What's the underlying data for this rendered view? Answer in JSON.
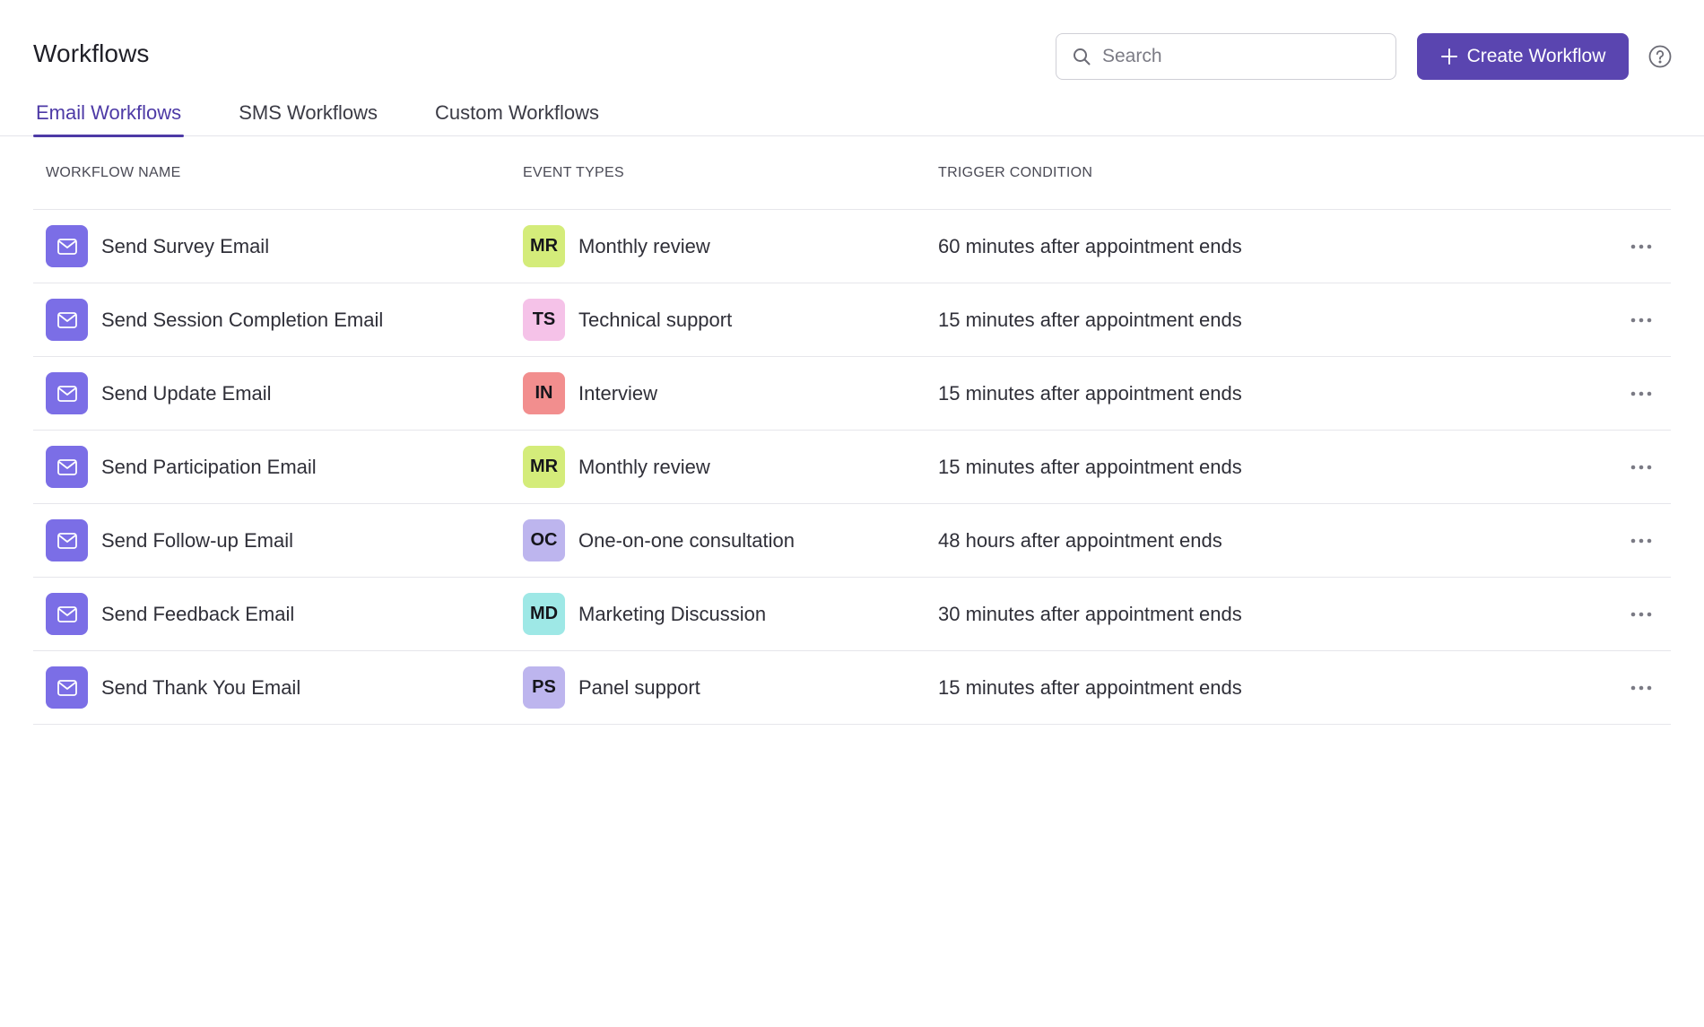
{
  "header": {
    "title": "Workflows",
    "search": {
      "placeholder": "Search",
      "value": ""
    },
    "create_button_label": "Create Workflow"
  },
  "tabs": [
    {
      "label": "Email Workflows",
      "active": true
    },
    {
      "label": "SMS Workflows",
      "active": false
    },
    {
      "label": "Custom Workflows",
      "active": false
    }
  ],
  "table": {
    "columns": [
      "WORKFLOW NAME",
      "EVENT TYPES",
      "TRIGGER CONDITION"
    ],
    "rows": [
      {
        "name": "Send Survey Email",
        "event_abbr": "MR",
        "event_color": "#d4ec7a",
        "event": "Monthly review",
        "trigger": "60 minutes after appointment ends"
      },
      {
        "name": "Send Session Completion Email",
        "event_abbr": "TS",
        "event_color": "#f5c2e8",
        "event": "Technical support",
        "trigger": "15 minutes after appointment ends"
      },
      {
        "name": "Send Update Email",
        "event_abbr": "IN",
        "event_color": "#f28e8e",
        "event": "Interview",
        "trigger": "15 minutes after appointment ends"
      },
      {
        "name": "Send Participation Email",
        "event_abbr": "MR",
        "event_color": "#d4ec7a",
        "event": "Monthly review",
        "trigger": "15 minutes after appointment ends"
      },
      {
        "name": "Send Follow-up Email",
        "event_abbr": "OC",
        "event_color": "#bdb5ee",
        "event": "One-on-one consultation",
        "trigger": "48 hours after appointment ends"
      },
      {
        "name": "Send Feedback Email",
        "event_abbr": "MD",
        "event_color": "#9ee8e6",
        "event": "Marketing Discussion",
        "trigger": "30 minutes after appointment ends"
      },
      {
        "name": "Send Thank You Email",
        "event_abbr": "PS",
        "event_color": "#bdb5ee",
        "event": "Panel support",
        "trigger": "15 minutes after appointment ends"
      }
    ]
  },
  "colors": {
    "accent": "#5a45b0",
    "active_tab": "#4d3aa6",
    "mail_badge": "#7b6ee6"
  },
  "icons": {
    "search": "search-icon",
    "create": "plus-icon",
    "help": "help-icon",
    "row_type": "mail-icon",
    "row_menu": "more-horizontal-icon"
  }
}
